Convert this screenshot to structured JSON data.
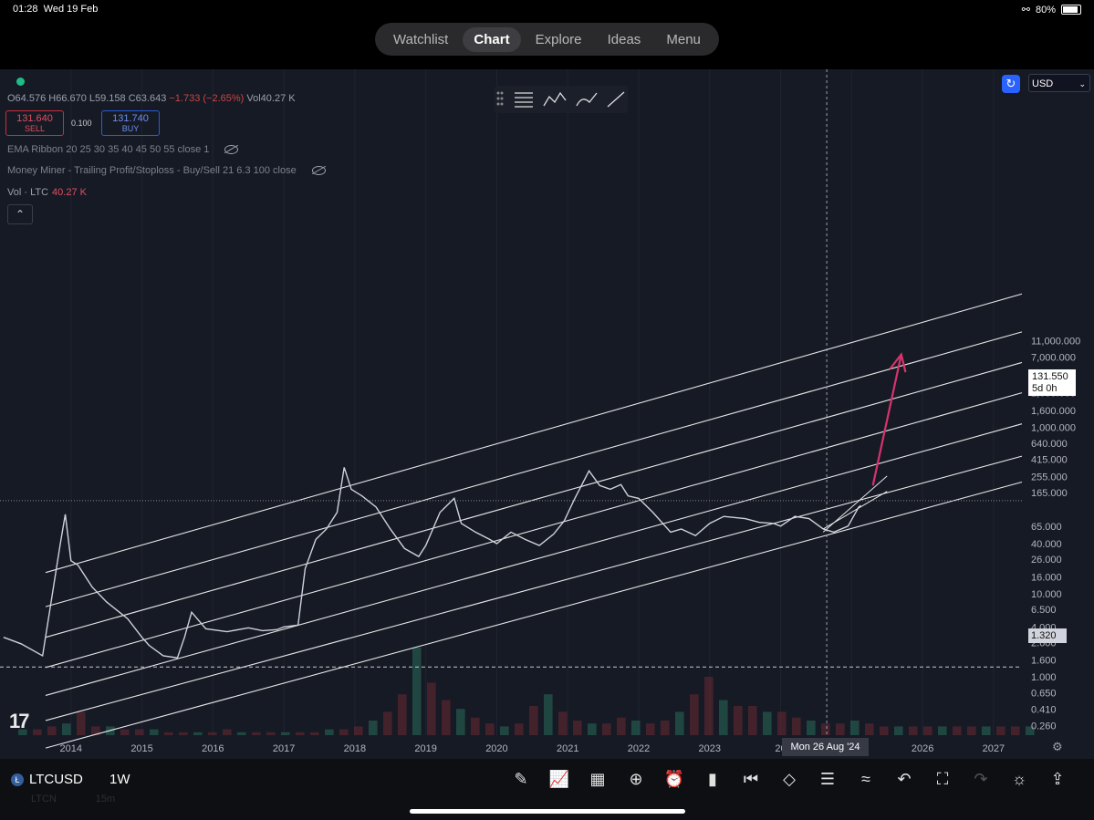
{
  "status": {
    "time": "01:28",
    "date": "Wed 19 Feb",
    "battery": "80%"
  },
  "nav": {
    "items": [
      "Watchlist",
      "Chart",
      "Explore",
      "Ideas",
      "Menu"
    ],
    "active": "Chart"
  },
  "header": {
    "ohlc_text": "O64.576 H66.670 L59.158 C63.643",
    "change": "−1.733 (−2.65%)",
    "vol_text": "Vol40.27 K",
    "sell_price": "131.640",
    "sell_label": "SELL",
    "buy_price": "131.740",
    "buy_label": "BUY",
    "spread": "0.100",
    "indicator1": "EMA Ribbon 20 25 30 35 40 45 50 55 close 1",
    "indicator2": "Money Miner - Trailing Profit/Stoploss - Buy/Sell 21 6.3 100 close",
    "volume_label": "Vol · LTC",
    "volume_value": "40.27 K",
    "currency": "USD"
  },
  "labels": {
    "last_price": "131.550",
    "countdown": "5d 0h",
    "line_price": "1.320",
    "crosshair_date": "Mon 26 Aug '24",
    "symbol": "LTCUSD",
    "timeframe": "1W",
    "ghost_symbol": "LTCN",
    "ghost_tf": "15m"
  },
  "icons": [
    "pencil-icon",
    "chart-icon",
    "grid-icon",
    "plus-icon",
    "alarm-icon",
    "candles-icon",
    "replay-icon",
    "layers-icon",
    "settings-icon",
    "trend-icon",
    "undo-icon",
    "fullscreen-icon",
    "redo-icon",
    "bulb-icon",
    "share-icon"
  ],
  "chart_data": {
    "type": "line",
    "symbol": "LTCUSD",
    "interval": "1W",
    "yscale": "log",
    "ylim": [
      0.2,
      20000000
    ],
    "xlim": [
      2013.0,
      2027.4
    ],
    "y_ticks": [
      "11,000.000",
      "7,000.000",
      "4,200.000",
      "2,600.000",
      "1,600.000",
      "1,000.000",
      "640.000",
      "415.000",
      "255.000",
      "165.000",
      "65.000",
      "40.000",
      "26.000",
      "16.000",
      "10.000",
      "6.500",
      "4.000",
      "2.600",
      "1.600",
      "1.000",
      "0.650",
      "0.410",
      "0.260"
    ],
    "x_ticks": [
      "2014",
      "2015",
      "2016",
      "2017",
      "2018",
      "2019",
      "2020",
      "2021",
      "2022",
      "2023",
      "20",
      "2025",
      "2026",
      "2027"
    ],
    "x_tick_pos": [
      2014,
      2015,
      2016,
      2017,
      2018,
      2019,
      2020,
      2021,
      2022,
      2023,
      2024,
      2025,
      2026,
      2027
    ],
    "price": {
      "x": [
        2013.05,
        2013.3,
        2013.6,
        2013.85,
        2013.92,
        2014.0,
        2014.1,
        2014.3,
        2014.5,
        2014.8,
        2015.0,
        2015.1,
        2015.3,
        2015.5,
        2015.6,
        2015.7,
        2015.9,
        2016.2,
        2016.5,
        2016.7,
        2016.9,
        2017.0,
        2017.2,
        2017.3,
        2017.45,
        2017.6,
        2017.75,
        2017.85,
        2017.95,
        2018.1,
        2018.3,
        2018.5,
        2018.7,
        2018.9,
        2019.0,
        2019.2,
        2019.4,
        2019.5,
        2019.7,
        2019.9,
        2020.0,
        2020.2,
        2020.4,
        2020.6,
        2020.8,
        2020.95,
        2021.1,
        2021.3,
        2021.45,
        2021.6,
        2021.75,
        2021.85,
        2022.0,
        2022.2,
        2022.45,
        2022.6,
        2022.8,
        2023.0,
        2023.2,
        2023.5,
        2023.7,
        2023.9,
        2024.0,
        2024.2,
        2024.4,
        2024.6,
        2024.75,
        2024.95,
        2025.1,
        2025.13
      ],
      "y": [
        3.0,
        2.5,
        1.8,
        40,
        90,
        25,
        22,
        12,
        8,
        5,
        3,
        2.4,
        1.8,
        1.7,
        3,
        6,
        3.8,
        3.5,
        3.9,
        3.6,
        3.7,
        4,
        4.2,
        20,
        45,
        60,
        95,
        330,
        180,
        150,
        110,
        60,
        35,
        28,
        38,
        95,
        140,
        70,
        55,
        45,
        40,
        55,
        45,
        38,
        52,
        75,
        140,
        300,
        200,
        180,
        205,
        150,
        140,
        95,
        55,
        60,
        50,
        70,
        85,
        80,
        72,
        70,
        65,
        85,
        80,
        60,
        55,
        65,
        110,
        115
      ]
    },
    "channel_lines": [
      {
        "x": [
          2013.0,
          2027.4
        ],
        "y": [
          18,
          40000
        ]
      },
      {
        "x": [
          2013.0,
          2027.4
        ],
        "y": [
          7,
          14000
        ]
      },
      {
        "x": [
          2013.0,
          2027.4
        ],
        "y": [
          3,
          6000
        ]
      },
      {
        "x": [
          2013.0,
          2027.4
        ],
        "y": [
          1.3,
          2600
        ]
      },
      {
        "x": [
          2013.0,
          2027.4
        ],
        "y": [
          0.6,
          1100
        ]
      },
      {
        "x": [
          2013.0,
          2027.4
        ],
        "y": [
          0.3,
          450
        ]
      },
      {
        "x": [
          2013.0,
          2027.4
        ],
        "y": [
          0.14,
          220
        ]
      }
    ],
    "last_price": 131.55,
    "horizontal_line": 1.32,
    "crosshair_x": 2024.65,
    "arrow": {
      "from": [
        2025.3,
        200
      ],
      "to": [
        2025.7,
        7500
      ],
      "color": "#d6336c"
    },
    "wedge": {
      "x": [
        2024.6,
        2025.5
      ],
      "y_lower": [
        55,
        260
      ],
      "y_upper": [
        60,
        170
      ]
    },
    "volume": [
      2,
      2,
      3,
      4,
      8,
      3,
      3,
      2,
      2,
      2,
      1,
      1,
      1,
      1,
      2,
      1,
      1,
      1,
      1,
      1,
      1,
      2,
      2,
      3,
      5,
      8,
      14,
      30,
      18,
      12,
      9,
      6,
      4,
      3,
      4,
      10,
      14,
      8,
      5,
      4,
      4,
      6,
      5,
      4,
      5,
      8,
      14,
      20,
      12,
      10,
      10,
      8,
      8,
      6,
      5,
      4,
      4,
      5,
      4,
      3,
      3,
      3,
      3,
      3,
      3,
      3,
      3,
      3,
      3,
      3
    ]
  }
}
